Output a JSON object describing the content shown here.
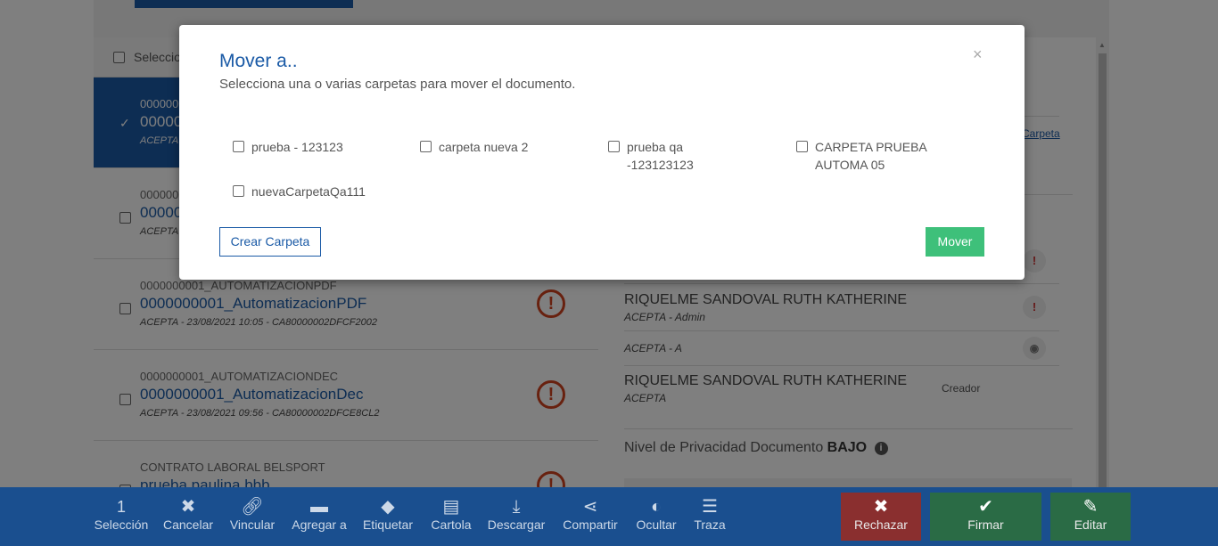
{
  "list": {
    "header_label": "Seleccionar",
    "rows": [
      {
        "code": "0000000",
        "name": "0000000",
        "meta": "ACEPTA -"
      },
      {
        "code": "0000000",
        "name": "0000000",
        "meta": "ACEPTA -"
      },
      {
        "code": "0000000001_AUTOMATIZACIONPDF",
        "name": "0000000001_AutomatizacionPDF",
        "meta": "ACEPTA - 23/08/2021 10:05 - CA80000002DFCF2002"
      },
      {
        "code": "0000000001_AUTOMATIZACIONDEC",
        "name": "0000000001_AutomatizacionDec",
        "meta": "ACEPTA - 23/08/2021 09:56 - CA80000002DFCE8CL2"
      },
      {
        "code": "CONTRATO LABORAL BELSPORT",
        "name": "prueba paulina bbb",
        "meta": ""
      }
    ]
  },
  "detail": {
    "carpeta_link": "Carpeta",
    "signers": [
      {
        "name": "RIQUELME SANDOVAL RUTH KATHERINE",
        "role": "ACEPTA - Admin"
      },
      {
        "name": "",
        "role": "ACEPTA - A"
      },
      {
        "name": "RIQUELME SANDOVAL RUTH KATHERINE",
        "role": "ACEPTA"
      }
    ],
    "creador_label": "Creador",
    "privacy_label": "Nivel de Privacidad Documento",
    "privacy_value": "BAJO"
  },
  "toolbar": {
    "count": "1",
    "items": [
      {
        "label": "Selección",
        "icon": "count"
      },
      {
        "label": "Cancelar",
        "icon": "close-icon"
      },
      {
        "label": "Vincular",
        "icon": "link-icon"
      },
      {
        "label": "Agregar a",
        "icon": "folder-icon"
      },
      {
        "label": "Etiquetar",
        "icon": "tag-icon"
      },
      {
        "label": "Cartola",
        "icon": "list-box-icon"
      },
      {
        "label": "Descargar",
        "icon": "download-icon"
      },
      {
        "label": "Compartir",
        "icon": "share-icon"
      },
      {
        "label": "Ocultar",
        "icon": "eye-slash-icon"
      },
      {
        "label": "Traza",
        "icon": "list-icon"
      }
    ],
    "actions": [
      {
        "label": "Rechazar",
        "icon": "x-icon",
        "color": "#c0392b"
      },
      {
        "label": "Firmar",
        "icon": "check-icon",
        "color": "#2e8b57"
      },
      {
        "label": "Editar",
        "icon": "pencil-icon",
        "color": "#2e8b57"
      }
    ]
  },
  "modal": {
    "title": "Mover a..",
    "subtitle": "Selecciona una o varias carpetas para mover el documento.",
    "close": "×",
    "folders": [
      {
        "line1": "prueba - 123123",
        "line2": ""
      },
      {
        "line1": "carpeta nueva 2",
        "line2": ""
      },
      {
        "line1": "prueba qa",
        "line2": "-123123123"
      },
      {
        "line1": "CARPETA PRUEBA",
        "line2": "AUTOMA 05"
      },
      {
        "line1": "nuevaCarpetaQa111",
        "line2": ""
      }
    ],
    "create_button": "Crear Carpeta",
    "move_button": "Mover"
  }
}
